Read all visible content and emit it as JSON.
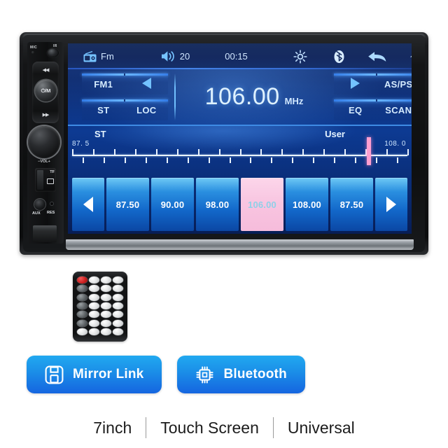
{
  "device": {
    "left_panel": {
      "mic_label": "MIC",
      "ir_label": "IR",
      "prev_glyph": "◀◀",
      "next_glyph": "▶▶",
      "power_label": "⏻/M",
      "vol_label": "−VOL+",
      "tf_label": "TF",
      "aux_label": "AUX",
      "res_label": "RES"
    },
    "screen": {
      "statusbar": {
        "source_icon": "radio-icon",
        "source_label": "Fm",
        "volume_icon": "speaker-icon",
        "volume_value": "20",
        "clock": "00:15",
        "brightness_icon": "sun-icon",
        "bluetooth_icon": "bluetooth-icon",
        "back_icon": "back-arrow-icon",
        "home_icon": "home-icon"
      },
      "tuner": {
        "band_label": "FM1",
        "prev_icon": "triangle-left-icon",
        "stereo_label": "ST",
        "local_label": "LOC",
        "next_icon": "triangle-right-icon",
        "asps_label": "AS/PS",
        "eq_label": "EQ",
        "scan_label": "SCAN",
        "frequency": "106.00",
        "unit": "MHz"
      },
      "scale": {
        "stereo_label": "ST",
        "user_label": "User",
        "low": "87. 5",
        "high": "108. 0",
        "cursor_percent": 87
      },
      "presets": {
        "prev_icon": "chevron-left-icon",
        "next_icon": "chevron-right-icon",
        "items": [
          {
            "label": "87.50",
            "active": false
          },
          {
            "label": "90.00",
            "active": false
          },
          {
            "label": "98.00",
            "active": false
          },
          {
            "label": "106.00",
            "active": true
          },
          {
            "label": "108.00",
            "active": false
          },
          {
            "label": "87.50",
            "active": false
          }
        ]
      }
    }
  },
  "remote": {
    "name": "ir-remote-control"
  },
  "badges": [
    {
      "icon": "mirror-link-icon",
      "label": "Mirror Link"
    },
    {
      "icon": "bluetooth-chip-icon",
      "label": "Bluetooth"
    }
  ],
  "footer": {
    "items": [
      "7inch",
      "Touch Screen",
      "Universal"
    ]
  },
  "colors": {
    "accent_blue": "#1b8fe8",
    "screen_blue": "#0d3a92",
    "cursor_pink": "#ff9fd0",
    "preset_active": "#f8c4e0"
  }
}
